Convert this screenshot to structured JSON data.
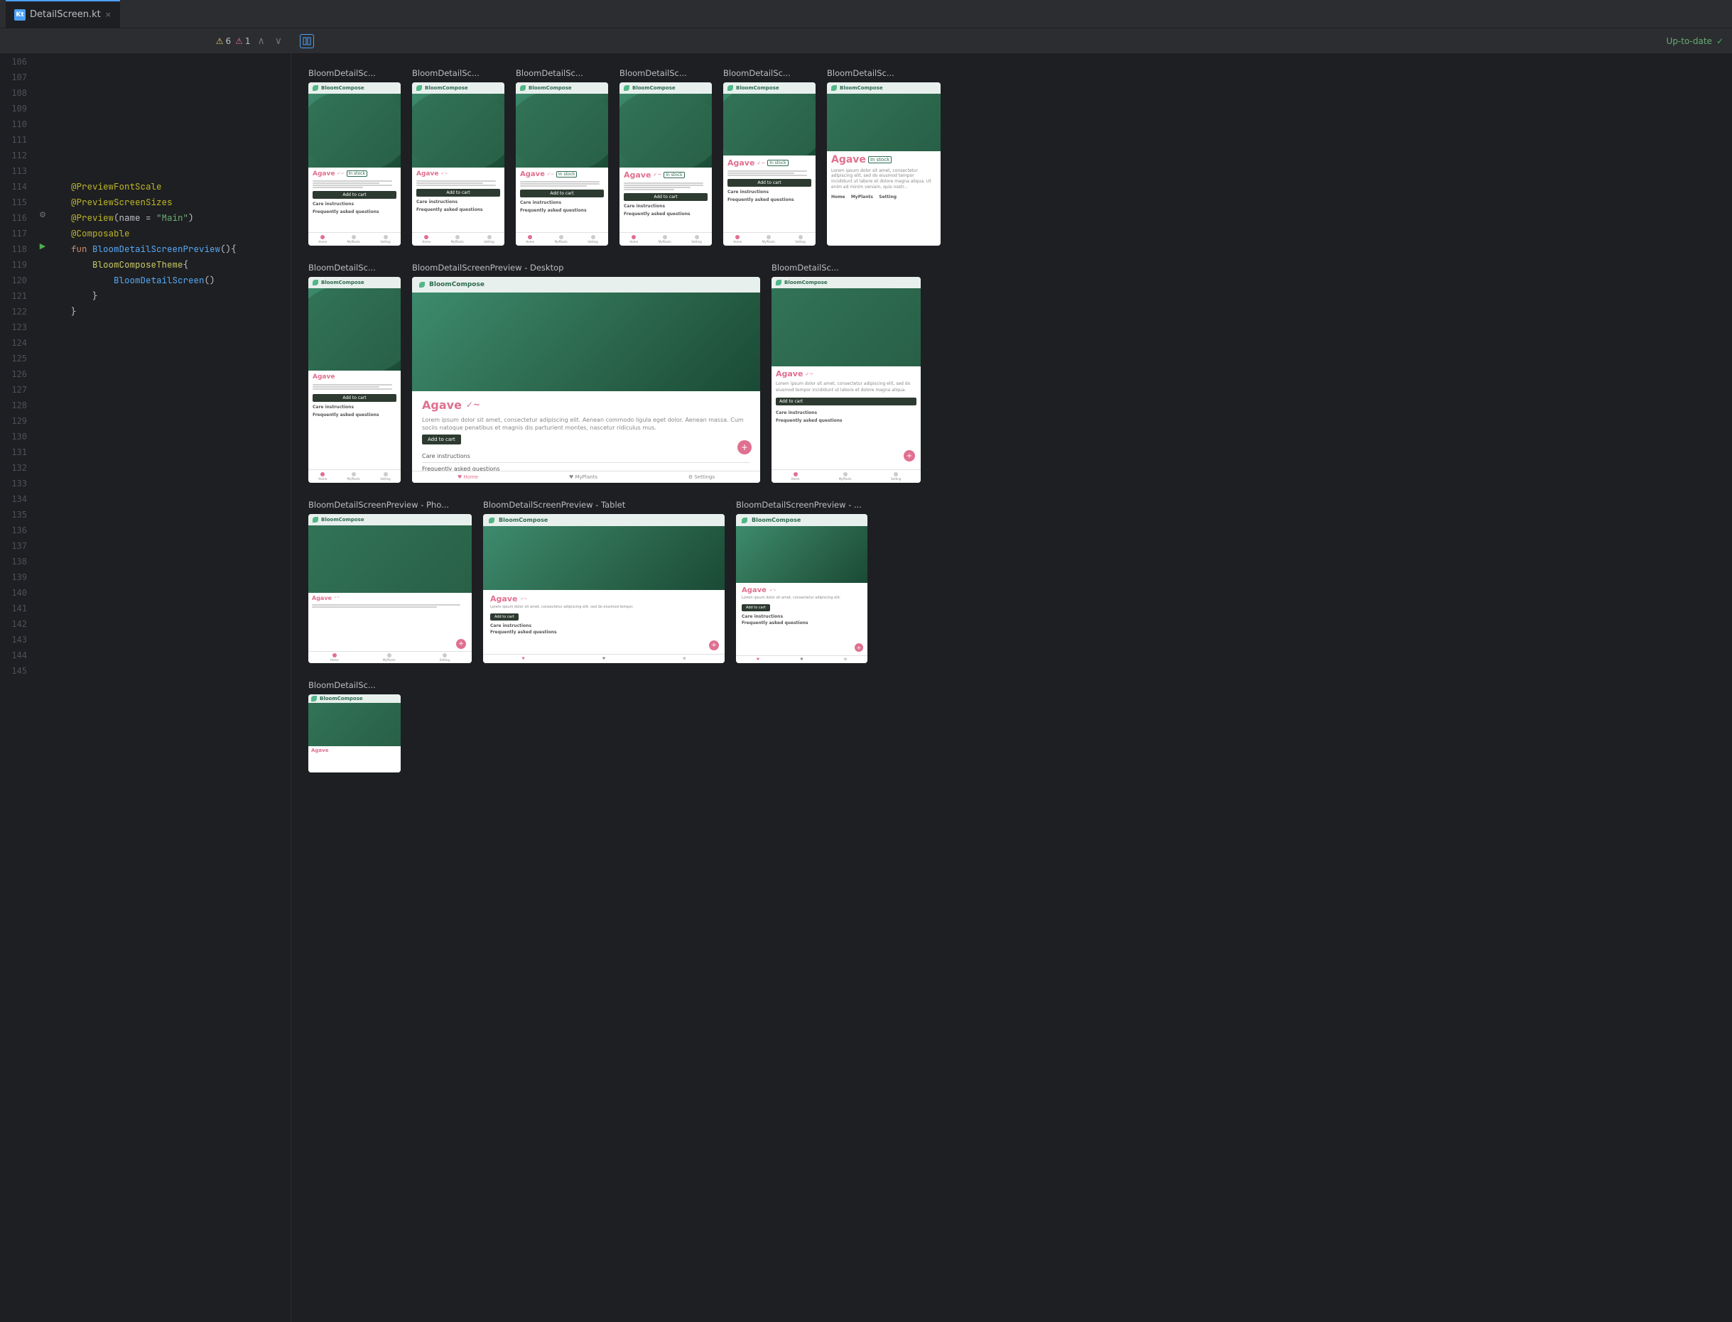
{
  "tab": {
    "filename": "DetailScreen.kt",
    "icon_label": "Kt",
    "close_label": "×"
  },
  "code_toolbar": {
    "warning_icon": "⚠",
    "warning_count": "6",
    "alert_icon": "⚠",
    "alert_count": "1",
    "up_arrow": "∧",
    "down_arrow": "∨"
  },
  "code_lines": [
    {
      "num": "106",
      "gutter": "",
      "text": ""
    },
    {
      "num": "107",
      "gutter": "",
      "text": ""
    },
    {
      "num": "108",
      "gutter": "",
      "text": ""
    },
    {
      "num": "109",
      "gutter": "",
      "text": ""
    },
    {
      "num": "110",
      "gutter": "",
      "text": ""
    },
    {
      "num": "111",
      "gutter": "",
      "text": ""
    },
    {
      "num": "112",
      "gutter": "",
      "text": ""
    },
    {
      "num": "113",
      "gutter": "",
      "text": ""
    },
    {
      "num": "114",
      "gutter": "",
      "text": "    @PreviewFontScale",
      "type": "annotation"
    },
    {
      "num": "115",
      "gutter": "",
      "text": "    @PreviewScreenSizes",
      "type": "annotation"
    },
    {
      "num": "116",
      "gutter": "gear",
      "text": "    @Preview(name = \"Main\")",
      "type": "annotation"
    },
    {
      "num": "117",
      "gutter": "",
      "text": "    @Composable",
      "type": "annotation"
    },
    {
      "num": "118",
      "gutter": "run",
      "text": "    fun BloomDetailScreenPreview(){",
      "type": "code"
    },
    {
      "num": "119",
      "gutter": "",
      "text": "        BloomComposeTheme{",
      "type": "code"
    },
    {
      "num": "120",
      "gutter": "",
      "text": "            BloomDetailScreen()",
      "type": "code"
    },
    {
      "num": "121",
      "gutter": "",
      "text": "        }",
      "type": "code"
    },
    {
      "num": "122",
      "gutter": "",
      "text": "    }",
      "type": "code"
    },
    {
      "num": "123",
      "gutter": "",
      "text": ""
    },
    {
      "num": "124",
      "gutter": "",
      "text": ""
    },
    {
      "num": "125",
      "gutter": "",
      "text": ""
    },
    {
      "num": "126",
      "gutter": "",
      "text": ""
    },
    {
      "num": "127",
      "gutter": "",
      "text": ""
    },
    {
      "num": "128",
      "gutter": "",
      "text": ""
    },
    {
      "num": "129",
      "gutter": "",
      "text": ""
    },
    {
      "num": "130",
      "gutter": "",
      "text": ""
    },
    {
      "num": "131",
      "gutter": "",
      "text": ""
    },
    {
      "num": "132",
      "gutter": "",
      "text": ""
    },
    {
      "num": "133",
      "gutter": "",
      "text": ""
    },
    {
      "num": "134",
      "gutter": "",
      "text": ""
    },
    {
      "num": "135",
      "gutter": "",
      "text": ""
    },
    {
      "num": "136",
      "gutter": "",
      "text": ""
    },
    {
      "num": "137",
      "gutter": "",
      "text": ""
    },
    {
      "num": "138",
      "gutter": "",
      "text": ""
    },
    {
      "num": "139",
      "gutter": "",
      "text": ""
    },
    {
      "num": "140",
      "gutter": "",
      "text": ""
    },
    {
      "num": "141",
      "gutter": "",
      "text": ""
    },
    {
      "num": "142",
      "gutter": "",
      "text": ""
    },
    {
      "num": "143",
      "gutter": "",
      "text": ""
    },
    {
      "num": "144",
      "gutter": "",
      "text": ""
    },
    {
      "num": "145",
      "gutter": "",
      "text": ""
    }
  ],
  "preview": {
    "status": "Up-to-date",
    "status_icon": "✓",
    "split_icon": "⊞",
    "preview_items_row1": [
      {
        "label": "BloomDetailSc...",
        "variant": "phone"
      },
      {
        "label": "BloomDetailSc...",
        "variant": "phone"
      },
      {
        "label": "BloomDetailSc...",
        "variant": "phone"
      },
      {
        "label": "BloomDetailSc...",
        "variant": "phone"
      },
      {
        "label": "BloomDetailSc...",
        "variant": "phone"
      },
      {
        "label": "BloomDetailSc...",
        "variant": "phone"
      }
    ],
    "preview_items_row2": [
      {
        "label": "BloomDetailSc...",
        "variant": "phone"
      },
      {
        "label": "BloomDetailScreenPreview - Desktop",
        "variant": "desktop"
      },
      {
        "label": "BloomDetailSc...",
        "variant": "medium"
      }
    ],
    "preview_items_row3": [
      {
        "label": "BloomDetailScreenPreview - Phone",
        "variant": "phone_wide"
      },
      {
        "label": "BloomDetailScreenPreview - Tablet",
        "variant": "tablet_wide"
      },
      {
        "label": "BloomDetailScreenPreview - ...",
        "variant": "tablet_small"
      }
    ],
    "preview_items_row4": [
      {
        "label": "BloomDetailSc...",
        "variant": "phone_single"
      }
    ],
    "plant_name": "Agave",
    "plant_name_italic": "✓~",
    "in_stock": "In stock",
    "add_to_cart": "Add to cart",
    "care_instructions": "Care instructions",
    "frequently_asked": "Frequently asked questions",
    "lorem_text": "Lorem ipsum dolor sit amet, consectetur adipiscing elit, sed do eiusmod tempor incididunt ut labore et dolore magna aliqua. Ut enim ad minim veniam, quis nostrud",
    "nav_items": [
      "Home",
      "MyPlants",
      "Setting"
    ]
  }
}
